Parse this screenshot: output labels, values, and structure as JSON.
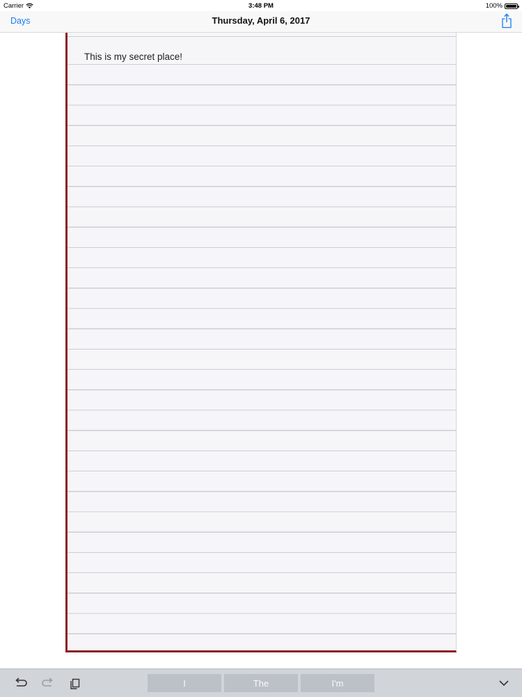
{
  "status_bar": {
    "carrier": "Carrier",
    "time": "3:48 PM",
    "battery": "100%"
  },
  "nav": {
    "back_label": "Days",
    "title": "Thursday, April 6, 2017"
  },
  "page": {
    "text": "This is my secret place!"
  },
  "keyboard": {
    "suggestions": [
      "I",
      "The",
      "I'm"
    ]
  },
  "colors": {
    "accent": "#1a7cf0",
    "page_border": "#8c1e24",
    "page_background": "#f6f5f8",
    "keyboard_bar": "#d1d4d9"
  },
  "icons": {
    "wifi": "wifi-icon",
    "battery": "battery-icon",
    "share": "share-icon",
    "undo": "undo-icon",
    "redo": "redo-icon",
    "paste": "paste-icon",
    "dismiss": "chevron-down-icon"
  }
}
